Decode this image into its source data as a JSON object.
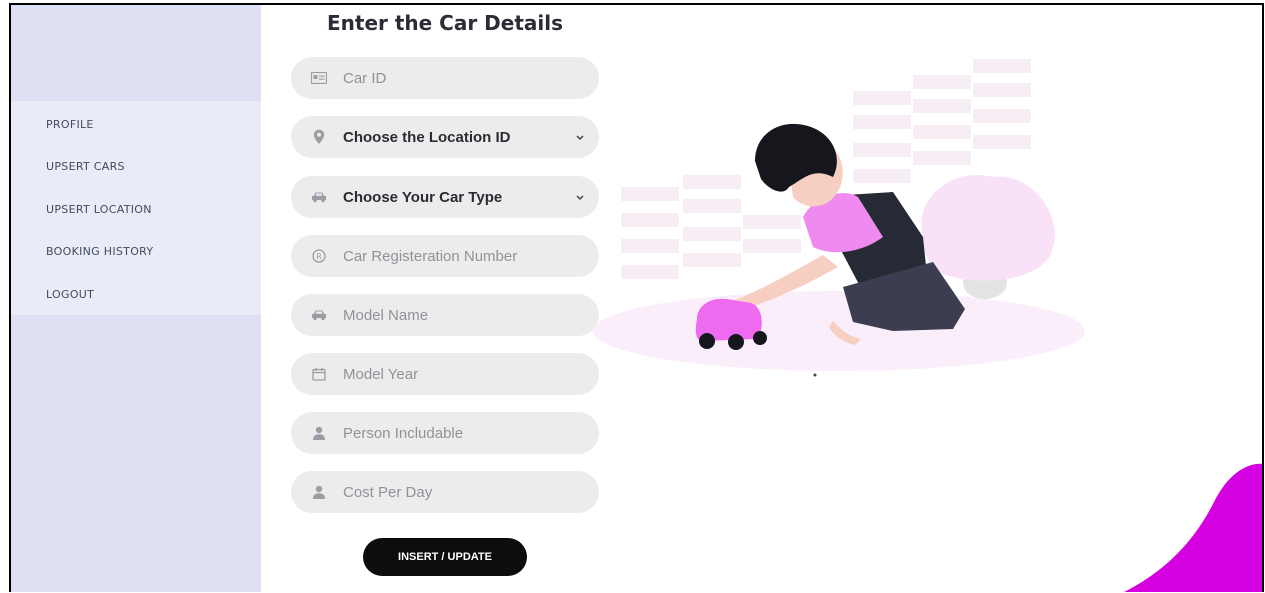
{
  "sidebar": {
    "items": [
      {
        "label": "PROFILE"
      },
      {
        "label": "UPSERT CARS"
      },
      {
        "label": "UPSERT LOCATION"
      },
      {
        "label": "BOOKING HISTORY"
      },
      {
        "label": "LOGOUT"
      }
    ]
  },
  "form": {
    "title": "Enter the Car Details",
    "car_id": {
      "placeholder": "Car ID",
      "icon": "id-card-icon"
    },
    "location": {
      "selected": "Choose the Location ID",
      "icon": "map-pin-icon"
    },
    "car_type": {
      "selected": "Choose Your Car Type",
      "icon": "car-icon"
    },
    "registration": {
      "placeholder": "Car Registeration Number",
      "icon": "registered-icon"
    },
    "model_name": {
      "placeholder": "Model Name",
      "icon": "car-icon"
    },
    "model_year": {
      "placeholder": "Model Year",
      "icon": "calendar-icon"
    },
    "persons": {
      "placeholder": "Person Includable",
      "icon": "user-icon"
    },
    "cost": {
      "placeholder": "Cost Per Day",
      "icon": "user-icon"
    },
    "submit_label": "INSERT / UPDATE"
  },
  "colors": {
    "sidebar_bg": "#dde1f3",
    "menu_bg": "#e8ebf8",
    "field_bg": "#ececec",
    "accent_magenta": "#d400e0",
    "button_bg": "#0d0d0d"
  }
}
